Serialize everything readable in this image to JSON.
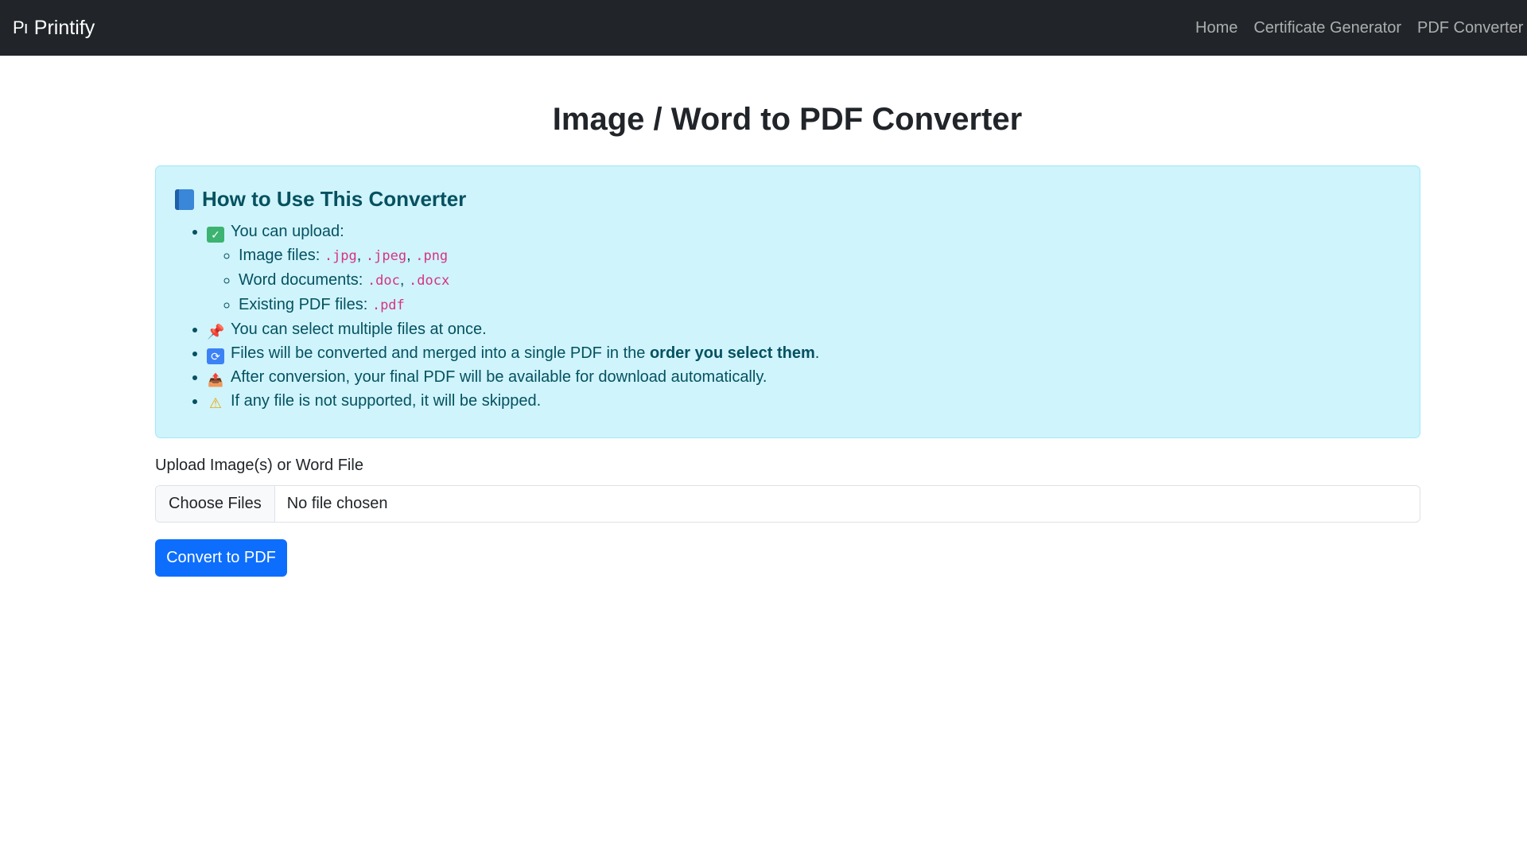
{
  "navbar": {
    "brand_logo": "Pı",
    "brand_name": "Printify",
    "links": [
      {
        "label": "Home"
      },
      {
        "label": "Certificate Generator"
      },
      {
        "label": "PDF Converter"
      }
    ]
  },
  "page": {
    "title": "Image / Word to PDF Converter"
  },
  "info": {
    "heading": "How to Use This Converter",
    "upload_intro": "You can upload:",
    "image_files_label": "Image files:",
    "image_exts": [
      ".jpg",
      ".jpeg",
      ".png"
    ],
    "word_docs_label": "Word documents:",
    "word_exts": [
      ".doc",
      ".docx"
    ],
    "pdf_files_label": "Existing PDF files:",
    "pdf_exts": [
      ".pdf"
    ],
    "multi_select": "You can select multiple files at once.",
    "merge_prefix": "Files will be converted and merged into a single PDF in the",
    "merge_bold": "order you select them",
    "merge_suffix": ".",
    "download_note": "After conversion, your final PDF will be available for download automatically.",
    "skip_note": "If any file is not supported, it will be skipped."
  },
  "form": {
    "upload_label": "Upload Image(s) or Word File",
    "choose_label": "Choose Files",
    "file_status": "No file chosen",
    "submit_label": "Convert to PDF"
  },
  "colors": {
    "navbar_bg": "#212529",
    "info_bg": "#cff4fc",
    "info_text": "#055160",
    "primary": "#0d6efd",
    "code": "#d63384"
  }
}
